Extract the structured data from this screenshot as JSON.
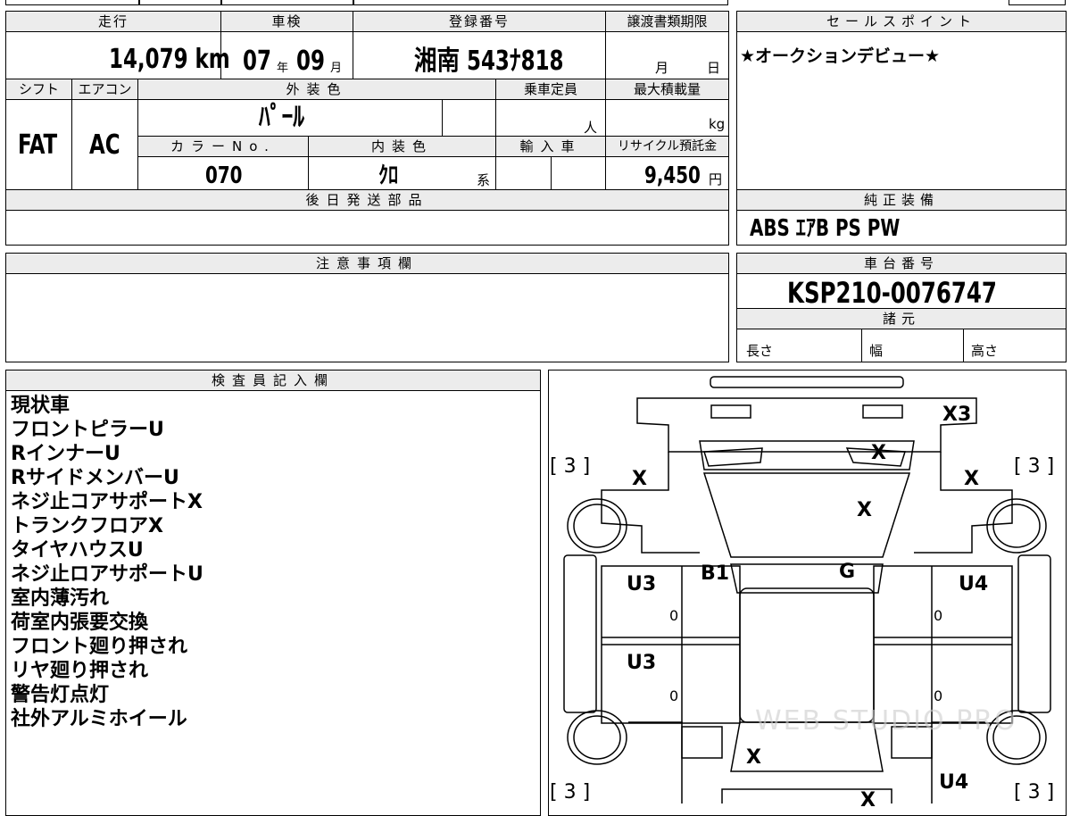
{
  "top": {
    "mileage_header": "走行",
    "mileage_value": "14,079 km",
    "inspection_header": "車検",
    "inspection_year": "07",
    "inspection_year_unit": "年",
    "inspection_month": "09",
    "inspection_month_unit": "月",
    "registration_header": "登録番号",
    "registration_value": "湘南 543ﾅ818",
    "transfer_header": "譲渡書類期限",
    "transfer_month": "月",
    "transfer_day": "日",
    "shift_header": "シフト",
    "shift_value": "FAT",
    "ac_header": "エアコン",
    "ac_value": "AC",
    "exterior_header": "外装色",
    "exterior_value": "ﾊﾟｰﾙ",
    "capacity_header": "乗車定員",
    "capacity_unit": "人",
    "maxload_header": "最大積載量",
    "maxload_unit": "kg",
    "colorno_header": "カラーNo.",
    "colorno_value": "070",
    "interior_header": "内装色",
    "interior_value": "ｸﾛ",
    "interior_suffix": "系",
    "import_header": "輸入車",
    "recycle_header": "リサイクル預託金",
    "recycle_value": "9,450",
    "recycle_unit": "円",
    "later_parts_header": "後日発送部品"
  },
  "sales": {
    "header": "セールスポイント",
    "value": "★オークションデビュー★"
  },
  "equipment": {
    "header": "純正装備",
    "value": "ABS ｴｱB PS PW"
  },
  "notes": {
    "header": "注意事項欄"
  },
  "chassis": {
    "header": "車台番号",
    "value": "KSP210-0076747",
    "spec_header": "諸元",
    "length": "長さ",
    "width": "幅",
    "height": "高さ"
  },
  "inspector": {
    "header": "検査員記入欄",
    "items": [
      "現状車",
      "フロントピラーU",
      "RインナーU",
      "RサイドメンバーU",
      "ネジ止コアサポートX",
      "トランクフロアX",
      "タイヤハウスU",
      "ネジ止ロアサポートU",
      "室内薄汚れ",
      "荷室内張要交換",
      "フロント廻り押され",
      "リヤ廻り押され",
      "警告灯点灯",
      "社外アルミホイール"
    ]
  },
  "diagram": {
    "marks": [
      "X3",
      "X",
      "X",
      "X",
      "X",
      "B1",
      "G",
      "U3",
      "U4",
      "U3",
      "X",
      "U4",
      "X"
    ],
    "tire_labels": [
      "[ 3 ]",
      "[ 3 ]",
      "[ 3 ]",
      "[ 3 ]"
    ],
    "zeros": [
      "0",
      "0",
      "0",
      "0"
    ],
    "watermark": "WEB STUDIO PRO"
  }
}
